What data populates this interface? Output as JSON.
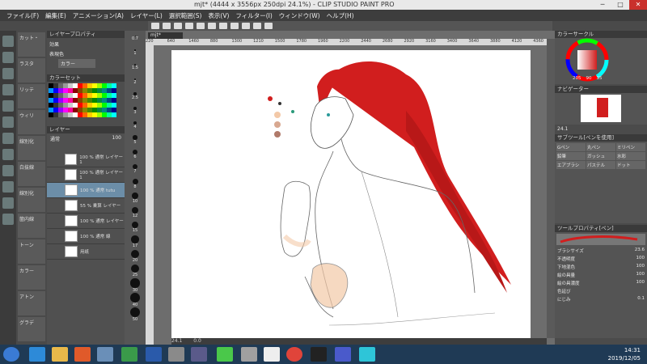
{
  "window": {
    "title": "mjt* (4444 x 3556px 250dpi 24.1%)  - CLIP STUDIO PAINT PRO",
    "controls": {
      "minimize": "─",
      "maximize": "□",
      "close": "✕"
    }
  },
  "menu": [
    "ファイル(F)",
    "編集(E)",
    "アニメーション(A)",
    "レイヤー(L)",
    "選択範囲(S)",
    "表示(V)",
    "フィルター(I)",
    "ウィンドウ(W)",
    "ヘルプ(H)"
  ],
  "canvas_tab": "mjt*",
  "subtool": {
    "items": [
      "カット・",
      "ラスタ",
      "リッテ",
      "ウィリ",
      "線別化",
      "白抜線",
      "線別化",
      "箇内線",
      "トーン",
      "カラー",
      "アトン",
      "グラデ"
    ]
  },
  "layer_property": {
    "title": "レイヤープロパティ",
    "effect_label": "効果",
    "expression_label": "表現色",
    "expression_value": "カラー"
  },
  "color_set": {
    "title": "カラーセット"
  },
  "layers": {
    "title": "レイヤー",
    "blend_mode": "通常",
    "opacity": "100",
    "rows": [
      {
        "label": "100 % 通常 レイヤー 1",
        "selected": false
      },
      {
        "label": "100 % 通常 レイヤー 1",
        "selected": false
      },
      {
        "label": "100 % 通常 tutu",
        "selected": true
      },
      {
        "label": "55 % 乗算 レイヤー",
        "selected": false
      },
      {
        "label": "100 % 通常 レイヤー",
        "selected": false
      },
      {
        "label": "100 % 通常 線",
        "selected": false
      },
      {
        "label": "用紙",
        "selected": false
      }
    ]
  },
  "brush_sizes": [
    "0.7",
    "1",
    "1.5",
    "2",
    "2.5",
    "3",
    "4",
    "5",
    "6",
    "7",
    "8",
    "10",
    "12",
    "15",
    "17",
    "20",
    "25",
    "30",
    "40",
    "50"
  ],
  "ruler_marks": [
    "220",
    "640",
    "1460",
    "880",
    "1300",
    "1210",
    "1500",
    "1780",
    "1960",
    "2200",
    "2440",
    "2680",
    "2920",
    "3160",
    "3400",
    "3640",
    "3880",
    "4120",
    "4360"
  ],
  "right_panel": {
    "color_wheel_title": "カラーサークル",
    "navigator_title": "ナビゲーター",
    "navigator_zoom": "24.1",
    "subtool_title": "サブツール[ペンを使用]",
    "subtool_groups": [
      "Gペン",
      "丸ペン",
      "ミリペン",
      "鉛筆",
      "ガッシュ",
      "水彩",
      "エアブラシ",
      "パステル",
      "ドット"
    ],
    "tool_property_title": "ツールプロパティ[ペン]",
    "brush_size_label": "ブラシサイズ",
    "brush_size_value": "23.6",
    "opacity_label": "不透明度",
    "opacity_value": "100",
    "lower_color_label": "下地混色",
    "lower_color_value": "100",
    "paint_amount_label": "絵の具量",
    "paint_amount_value": "100",
    "paint_density_label": "絵の具濃度",
    "paint_density_value": "100",
    "color_stretch_label": "色延び",
    "color_stretch_value": "",
    "blur_label": "にじみ",
    "blur_value": "0.1",
    "color_values": [
      "205",
      "90",
      "35"
    ]
  },
  "status": {
    "zoom": "24.1",
    "angle": "0.0"
  },
  "taskbar": {
    "time": "14:31",
    "date": "2019/12/05"
  },
  "colors": {
    "hair": "#d11e1e",
    "skin": "#f3c9a8",
    "accent": "#6c8ea8",
    "titlebar": "#e9e9e9",
    "taskbar": "#1f3a55"
  }
}
